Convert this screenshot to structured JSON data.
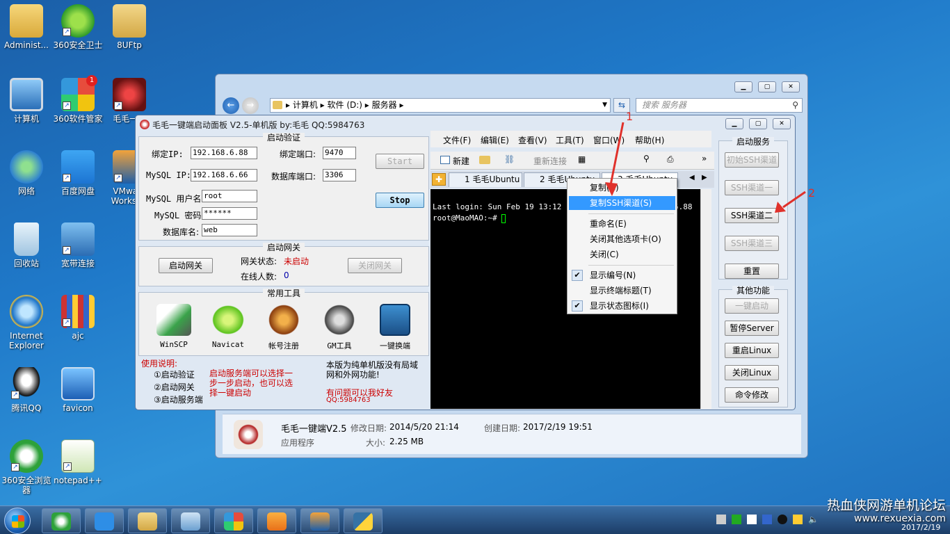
{
  "desktop": {
    "icons": [
      {
        "label": "Administ..."
      },
      {
        "label": "360安全卫士"
      },
      {
        "label": "8UFtp"
      },
      {
        "label": "计算机"
      },
      {
        "label": "360软件管家"
      },
      {
        "label": "毛毛一..."
      },
      {
        "label": "网络"
      },
      {
        "label": "百度网盘"
      },
      {
        "label": "VMwa..."
      },
      {
        "label": "Workst..."
      },
      {
        "label": "回收站"
      },
      {
        "label": "宽带连接"
      },
      {
        "label": "Internet"
      },
      {
        "label": "Explorer"
      },
      {
        "label": "ajc"
      },
      {
        "label": "腾讯QQ"
      },
      {
        "label": "favicon"
      },
      {
        "label": "360安全浏览"
      },
      {
        "label": "器"
      },
      {
        "label": "notepad++"
      }
    ],
    "badge_count": "1"
  },
  "explorer": {
    "breadcrumb": [
      "计算机",
      "软件 (D:)",
      "服务器"
    ],
    "search_placeholder": "搜索 服务器",
    "details": {
      "name": "毛毛一键端V2.5",
      "modified_label": "修改日期:",
      "modified": "2014/5/20 21:14",
      "created_label": "创建日期:",
      "created": "2017/2/19 19:51",
      "type": "应用程序",
      "size_label": "大小:",
      "size": "2.25 MB"
    }
  },
  "panel": {
    "title": "毛毛一键端启动面板 V2.5-单机版 by:毛毛  QQ:5984763",
    "verify": {
      "title": "启动验证",
      "bind_ip_label": "绑定IP:",
      "bind_ip": "192.168.6.88",
      "bind_port_label": "绑定端口:",
      "bind_port": "9470",
      "mysql_ip_label": "MySQL IP:",
      "mysql_ip": "192.168.6.66",
      "db_port_label": "数据库端口:",
      "db_port": "3306",
      "mysql_user_label": "MySQL 用户名:",
      "mysql_user": "root",
      "mysql_pass_label": "MySQL 密码:",
      "mysql_pass": "******",
      "db_name_label": "数据库名:",
      "db_name": "web",
      "start": "Start",
      "stop": "Stop"
    },
    "gateway": {
      "title": "启动网关",
      "start_btn": "启动网关",
      "status_label": "网关状态:",
      "status": "未启动",
      "online_label": "在线人数:",
      "online": "0",
      "close_btn": "关闭网关"
    },
    "tools": {
      "title": "常用工具",
      "items": [
        "WinSCP",
        "Navicat",
        "帐号注册",
        "GM工具",
        "一键换端"
      ]
    },
    "instructions": {
      "title": "使用说明:",
      "steps": [
        "①启动验证",
        "②启动网关",
        "③启动服务端"
      ],
      "note": "启动服务端可以选择一步一步启动，也可以选择一键启动",
      "info": "本版为纯单机版没有局域网和外网功能!",
      "contact": "有问题可以我好友",
      "qq": "QQ:5984763"
    },
    "services": {
      "title": "启动服务",
      "buttons": [
        "初始SSH渠道",
        "SSH渠道一",
        "SSH渠道二",
        "SSH渠道三",
        "重置"
      ]
    },
    "other": {
      "title": "其他功能",
      "buttons": [
        "一键启动",
        "暂停Server",
        "重启Linux",
        "关闭Linux",
        "命令修改"
      ]
    }
  },
  "xshell": {
    "menu": [
      "文件(F)",
      "编辑(E)",
      "查看(V)",
      "工具(T)",
      "窗口(W)",
      "帮助(H)"
    ],
    "toolbar": {
      "new": "新建",
      "reconnect": "重新连接"
    },
    "tabs": [
      "1 毛毛Ubuntu",
      "2 毛毛Ubuntu",
      "3 毛毛Ubuntu"
    ],
    "terminal": {
      "line1": "Last login: Sun Feb 19 13:12",
      "line1_tail": "6.88",
      "prompt": "root@MaoMAO:~# "
    }
  },
  "context_menu": {
    "items": [
      {
        "label": "复制(C)"
      },
      {
        "label": "复制SSH渠道(S)"
      },
      {
        "label": "重命名(E)"
      },
      {
        "label": "关闭其他选项卡(O)"
      },
      {
        "label": "关闭(C)"
      },
      {
        "label": "显示编号(N)"
      },
      {
        "label": "显示终端标题(T)"
      },
      {
        "label": "显示状态图标(I)"
      }
    ]
  },
  "annotations": {
    "arrow1": "1",
    "arrow2": "2"
  },
  "watermark": {
    "line1": "热血侠网游单机论坛",
    "line2": "www.rexuexia.com"
  },
  "tray": {
    "date": "2017/2/19"
  }
}
